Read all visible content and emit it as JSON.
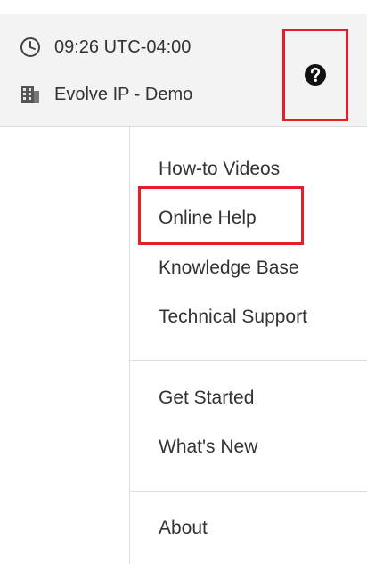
{
  "header": {
    "time_text": "09:26 UTC-04:00",
    "time_icon": "clock-icon",
    "org_text": "Evolve IP - Demo",
    "org_icon": "building-icon"
  },
  "help_button": {
    "icon": "question-circle-icon",
    "highlight_color": "#e81d28"
  },
  "menu": {
    "items": [
      {
        "label": "How-to Videos"
      },
      {
        "label": "Online Help",
        "highlighted": true
      },
      {
        "label": "Knowledge Base"
      },
      {
        "label": "Technical Support"
      },
      {
        "label": "Get Started"
      },
      {
        "label": "What's New"
      },
      {
        "label": "About"
      }
    ]
  },
  "colors": {
    "header_background": "#f3f3f3",
    "highlight": "#e81d28",
    "text": "#333333"
  }
}
